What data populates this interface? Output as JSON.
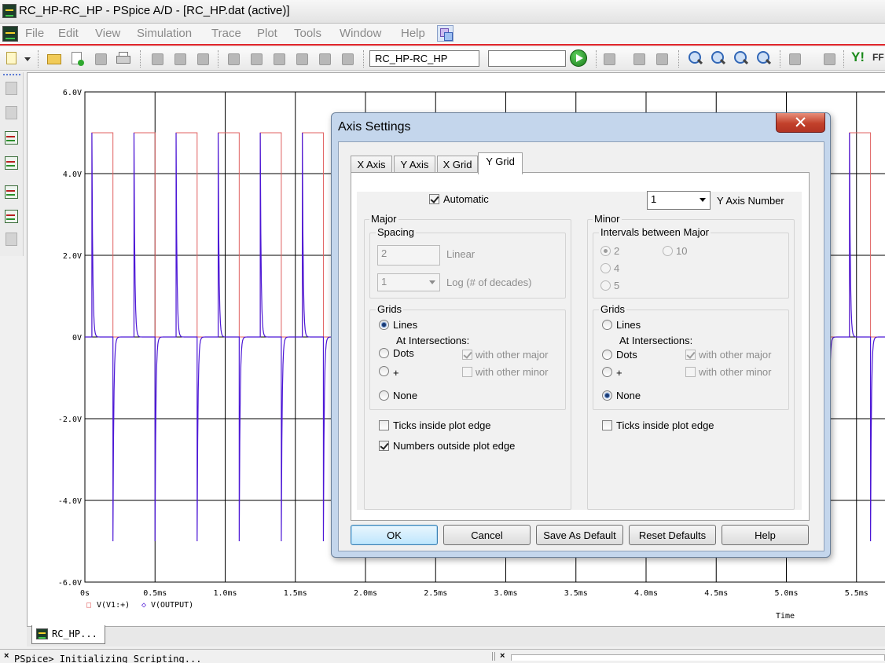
{
  "window": {
    "title": "RC_HP-RC_HP - PSpice A/D  - [RC_HP.dat (active)]"
  },
  "menu": [
    "File",
    "Edit",
    "View",
    "Simulation",
    "Trace",
    "Plot",
    "Tools",
    "Window",
    "Help"
  ],
  "toolbar": {
    "profile": "RC_HP-RC_HP"
  },
  "plot": {
    "y_ticks": [
      "6.0V",
      "4.0V",
      "2.0V",
      "0V",
      "-2.0V",
      "-4.0V",
      "-6.0V"
    ],
    "x_ticks": [
      "0s",
      "0.5ms",
      "1.0ms",
      "1.5ms",
      "2.0ms",
      "2.5ms",
      "3.0ms",
      "3.5ms",
      "4.0ms",
      "4.5ms",
      "5.0ms",
      "5.5ms"
    ],
    "xlabel": "Time",
    "legend": [
      "V(V1:+)",
      "V(OUTPUT)"
    ],
    "legend_markers": [
      "□",
      "◇"
    ],
    "colors": {
      "input": "#e06060",
      "output": "#4c17d6",
      "grid": "#000000"
    }
  },
  "chart_data": {
    "type": "line",
    "xlabel": "Time",
    "ylim": [
      -6.0,
      6.0
    ],
    "xlim": [
      "0s",
      "5.6ms"
    ],
    "series": [
      {
        "name": "V(V1:+)",
        "description_pulse": {
          "low": 0,
          "high": 5,
          "period_ms": 0.3,
          "high_ms": 0.15,
          "first_rise_ms": 0.05
        }
      },
      {
        "name": "V(OUTPUT)",
        "description_spikes": {
          "peak": 5,
          "trough": -5
        }
      }
    ]
  },
  "dialog": {
    "title": "Axis Settings",
    "close_glyph": "✕",
    "tabs": [
      "X Axis",
      "Y Axis",
      "X Grid",
      "Y Grid"
    ],
    "active_tab": "Y Grid",
    "automatic": "Automatic",
    "y_axis_number": {
      "value": "1",
      "label": "Y Axis Number"
    },
    "major": {
      "title": "Major",
      "spacing": "Spacing",
      "linear_value": "2",
      "linear_label": "Linear",
      "log_value": "1",
      "log_label": "Log (# of decades)",
      "grids": "Grids",
      "lines": "Lines",
      "at_intersections": "At Intersections:",
      "dots": "Dots",
      "plus": "+",
      "with_other_major": "with other major",
      "with_other_minor": "with other minor",
      "none": "None",
      "ticks_inside": "Ticks inside plot edge",
      "numbers_outside": "Numbers outside plot edge"
    },
    "minor": {
      "title": "Minor",
      "intervals": "Intervals between Major",
      "options": [
        "2",
        "4",
        "5",
        "10"
      ],
      "grids": "Grids",
      "lines": "Lines",
      "at_intersections": "At Intersections:",
      "dots": "Dots",
      "plus": "+",
      "with_other_major": "with other major",
      "with_other_minor": "with other minor",
      "none": "None",
      "ticks_inside": "Ticks inside plot edge"
    },
    "buttons": [
      "OK",
      "Cancel",
      "Save As Default",
      "Reset Defaults",
      "Help"
    ]
  },
  "bottom": {
    "doc_tab": "RC_HP...",
    "output_close": "×",
    "output_text": "PSpice> Initializing Scripting..."
  }
}
